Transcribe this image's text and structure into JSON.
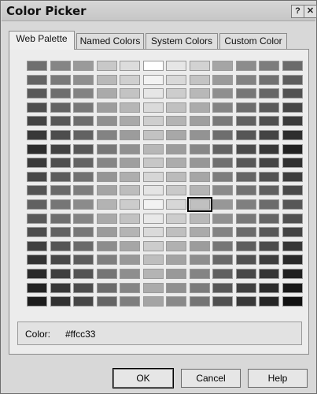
{
  "window": {
    "title": "Color Picker",
    "help_glyph": "?",
    "close_glyph": "✕"
  },
  "tabs": [
    {
      "label": "Web Palette",
      "active": true
    },
    {
      "label": "Named Colors",
      "active": false
    },
    {
      "label": "System Colors",
      "active": false
    },
    {
      "label": "Custom Color",
      "active": false
    }
  ],
  "palette": {
    "columns": 12,
    "rows": 18,
    "selected": {
      "row": 10,
      "col": 7
    },
    "colors": [
      [
        "#6f6f6f",
        "#858585",
        "#9a9a9a",
        "#c8c8c8",
        "#dcdcdc",
        "#ffffff",
        "#e6e6e6",
        "#d2d2d2",
        "#a5a5a5",
        "#8c8c8c",
        "#7d7d7d",
        "#6b6b6b"
      ],
      [
        "#646464",
        "#7a7a7a",
        "#8f8f8f",
        "#b9b9b9",
        "#d0d0d0",
        "#f2f2f2",
        "#d9d9d9",
        "#c4c4c4",
        "#9a9a9a",
        "#828282",
        "#717171",
        "#5e5e5e"
      ],
      [
        "#595959",
        "#6e6e6e",
        "#838383",
        "#aaaaaa",
        "#c3c3c3",
        "#e6e6e6",
        "#cdcdcd",
        "#b8b8b8",
        "#8f8f8f",
        "#777777",
        "#666666",
        "#525252"
      ],
      [
        "#4e4e4e",
        "#636363",
        "#787878",
        "#9d9d9d",
        "#b6b6b6",
        "#dadada",
        "#c0c0c0",
        "#ababab",
        "#848484",
        "#6c6c6c",
        "#5a5a5a",
        "#464646"
      ],
      [
        "#434343",
        "#585858",
        "#6d6d6d",
        "#909090",
        "#a9a9a9",
        "#cecece",
        "#b4b4b4",
        "#9f9f9f",
        "#797979",
        "#616161",
        "#4f4f4f",
        "#3a3a3a"
      ],
      [
        "#383838",
        "#4d4d4d",
        "#626262",
        "#838383",
        "#9c9c9c",
        "#c2c2c2",
        "#a8a8a8",
        "#939393",
        "#6e6e6e",
        "#565656",
        "#444444",
        "#2e2e2e"
      ],
      [
        "#2d2d2d",
        "#424242",
        "#575757",
        "#777777",
        "#909090",
        "#b7b7b7",
        "#9c9c9c",
        "#878787",
        "#636363",
        "#4b4b4b",
        "#383838",
        "#222222"
      ],
      [
        "#3a3a3a",
        "#4f4f4f",
        "#646464",
        "#868686",
        "#9f9f9f",
        "#c7c7c7",
        "#acacac",
        "#979797",
        "#707070",
        "#585858",
        "#454545",
        "#303030"
      ],
      [
        "#474747",
        "#5c5c5c",
        "#717171",
        "#959595",
        "#aeaeae",
        "#d6d6d6",
        "#bbbbbb",
        "#a6a6a6",
        "#7d7d7d",
        "#656565",
        "#525252",
        "#3d3d3d"
      ],
      [
        "#545454",
        "#696969",
        "#7e7e7e",
        "#a4a4a4",
        "#bdbdbd",
        "#e4e4e4",
        "#c9c9c9",
        "#b4b4b4",
        "#8a8a8a",
        "#727272",
        "#5f5f5f",
        "#4a4a4a"
      ],
      [
        "#616161",
        "#767676",
        "#8b8b8b",
        "#b3b3b3",
        "#cccccc",
        "#f2f2f2",
        "#d7d7d7",
        "#c0c0c0",
        "#979797",
        "#7f7f7f",
        "#6c6c6c",
        "#575757"
      ],
      [
        "#5a5a5a",
        "#6f6f6f",
        "#848484",
        "#a9a9a9",
        "#c2c2c2",
        "#e8e8e8",
        "#cdcdcd",
        "#b8b8b8",
        "#909090",
        "#787878",
        "#656565",
        "#505050"
      ],
      [
        "#4d4d4d",
        "#626262",
        "#777777",
        "#9b9b9b",
        "#b4b4b4",
        "#dadada",
        "#bfbfbf",
        "#aaaaaa",
        "#838383",
        "#6b6b6b",
        "#585858",
        "#434343"
      ],
      [
        "#404040",
        "#555555",
        "#6a6a6a",
        "#8d8d8d",
        "#a6a6a6",
        "#cccccc",
        "#b1b1b1",
        "#9c9c9c",
        "#767676",
        "#5e5e5e",
        "#4b4b4b",
        "#363636"
      ],
      [
        "#333333",
        "#484848",
        "#5d5d5d",
        "#7f7f7f",
        "#989898",
        "#bebebe",
        "#a3a3a3",
        "#8e8e8e",
        "#696969",
        "#515151",
        "#3e3e3e",
        "#292929"
      ],
      [
        "#2a2a2a",
        "#3f3f3f",
        "#545454",
        "#757575",
        "#8e8e8e",
        "#b4b4b4",
        "#999999",
        "#848484",
        "#606060",
        "#484848",
        "#353535",
        "#202020"
      ],
      [
        "#222222",
        "#373737",
        "#4c4c4c",
        "#6c6c6c",
        "#858585",
        "#ababab",
        "#909090",
        "#7b7b7b",
        "#575757",
        "#3f3f3f",
        "#2c2c2c",
        "#181818"
      ],
      [
        "#1c1c1c",
        "#313131",
        "#464646",
        "#656565",
        "#7e7e7e",
        "#a4a4a4",
        "#898989",
        "#747474",
        "#505050",
        "#383838",
        "#252525",
        "#111111"
      ]
    ]
  },
  "color_field": {
    "label": "Color:",
    "value": "#ffcc33"
  },
  "buttons": {
    "ok": "OK",
    "cancel": "Cancel",
    "help": "Help"
  }
}
